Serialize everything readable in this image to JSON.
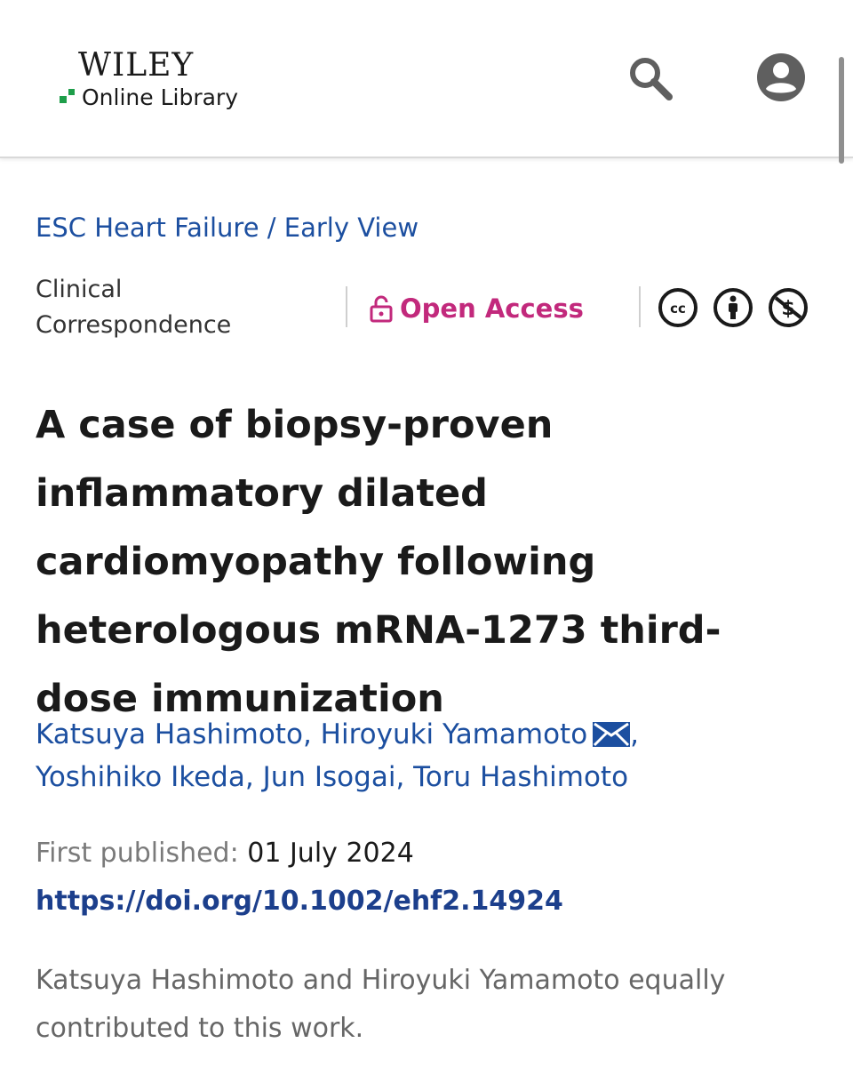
{
  "header": {
    "logo_brand": "WILEY",
    "logo_sub": "Online Library",
    "search_icon": "search-icon",
    "account_icon": "account-icon"
  },
  "breadcrumb": {
    "journal": "ESC Heart Failure",
    "separator": "/",
    "section": "Early View"
  },
  "meta": {
    "article_type_line1": "Clinical",
    "article_type_line2": "Correspondence",
    "open_access_label": "Open Access",
    "license_icons": [
      "cc-icon",
      "attribution-icon",
      "noncommercial-icon"
    ]
  },
  "article": {
    "title": "A case of biopsy-proven inflammatory dilated cardiomyopathy following heterologous mRNA-1273 third-dose immunization",
    "authors": [
      "Katsuya Hashimoto",
      "Hiroyuki Yamamoto",
      "Yoshihiko Ikeda",
      "Jun Isogai",
      "Toru Hashimoto"
    ],
    "author_separator": ",",
    "published_label": "First published:",
    "published_date": "01 July 2024",
    "doi": "https://doi.org/10.1002/ehf2.14924",
    "note": "Katsuya Hashimoto and Hiroyuki Yamamoto equally contributed to this work."
  },
  "colors": {
    "link_blue": "#1c4fa0",
    "open_access_pink": "#c2297c",
    "logo_green": "#1e9e4a"
  }
}
